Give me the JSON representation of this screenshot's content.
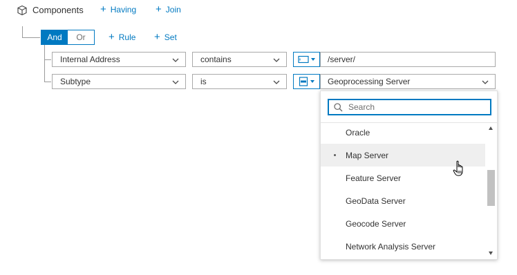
{
  "header": {
    "title": "Components",
    "having_label": "Having",
    "join_label": "Join"
  },
  "group": {
    "and_label": "And",
    "or_label": "Or",
    "add_rule_label": "Rule",
    "add_set_label": "Set",
    "active": "And"
  },
  "rules": [
    {
      "field": "Internal Address",
      "operator": "contains",
      "value_type": "text",
      "value": "/server/"
    },
    {
      "field": "Subtype",
      "operator": "is",
      "value_type": "list",
      "value": "Geoprocessing Server"
    }
  ],
  "dropdown": {
    "search_placeholder": "Search",
    "options": [
      "Oracle",
      "Map Server",
      "Feature Server",
      "GeoData Server",
      "Geocode Server",
      "Network Analysis Server"
    ],
    "hovered_option": "Map Server"
  },
  "colors": {
    "accent": "#0079c1",
    "text": "#323232",
    "border": "#a9a9a9",
    "hover": "#efefef"
  }
}
